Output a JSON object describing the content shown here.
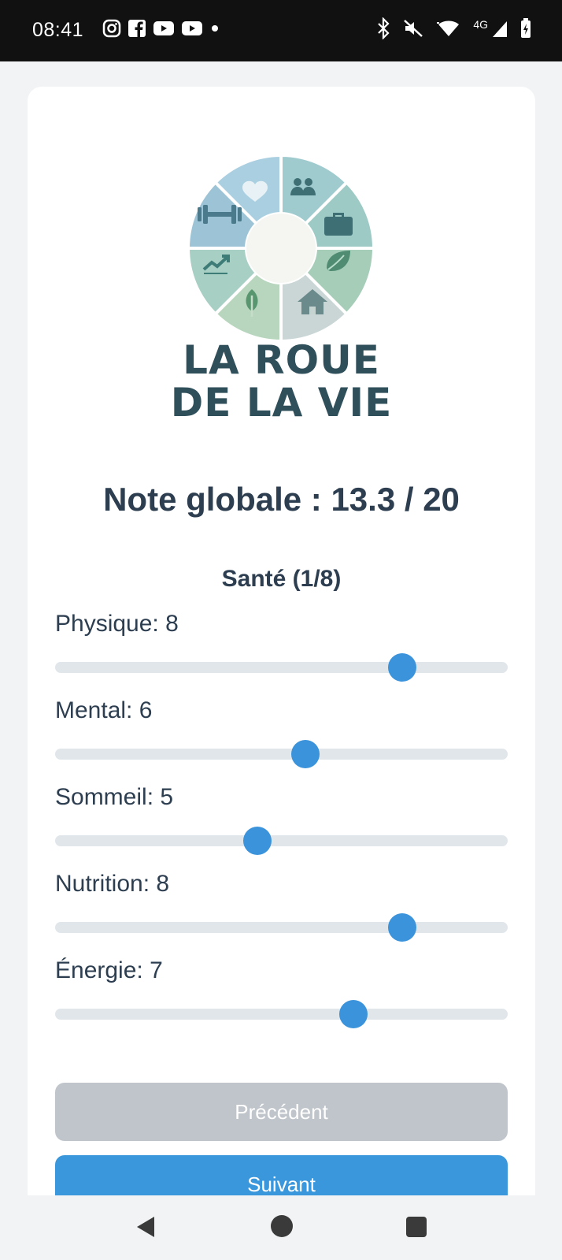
{
  "status_bar": {
    "time": "08:41",
    "network": "4G"
  },
  "logo": {
    "line1": "LA ROUE",
    "line2": "DE LA VIE",
    "segments": [
      "heart-icon",
      "people-icon",
      "briefcase-icon",
      "leaf-icon",
      "home-icon",
      "sprout-icon",
      "trend-icon",
      "dumbbell-icon"
    ]
  },
  "score": {
    "text": "Note globale : 13.3 / 20",
    "value": 13.3,
    "max": 20
  },
  "section": {
    "title": "Santé (1/8)"
  },
  "sliders": [
    {
      "label": "Physique: 8",
      "value": 8
    },
    {
      "label": "Mental: 6",
      "value": 6
    },
    {
      "label": "Sommeil: 5",
      "value": 5
    },
    {
      "label": "Nutrition: 8",
      "value": 8
    },
    {
      "label": "Énergie: 7",
      "value": 7
    }
  ],
  "slider_range": {
    "min": 1,
    "max": 10
  },
  "buttons": {
    "previous": "Précédent",
    "next": "Suivant"
  },
  "colors": {
    "accent": "#3a93db",
    "disabled": "#bfc5ca",
    "text": "#2d3e50",
    "logo_text": "#2f4f5a"
  }
}
